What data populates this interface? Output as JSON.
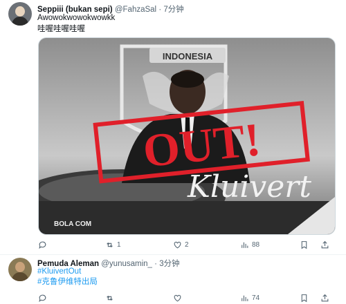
{
  "post1": {
    "display_name": "Seppiii (bukan sepi)",
    "handle": "@FahzaSal",
    "separator": "·",
    "time": "7分钟",
    "text_line1": "Awowokwowokwowkk",
    "text_line2": "哇喔哇喔哇喔",
    "media": {
      "badge_text": "INDONESIA",
      "stamp_text": "OUT!",
      "signature": "Kluivert",
      "watermark": "BOLA COM",
      "stamp_color": "#e0202a"
    },
    "actions": {
      "reply_count": "",
      "retweet_count": "1",
      "like_count": "2",
      "views_count": "88"
    }
  },
  "post2": {
    "display_name": "Pemuda Aleman",
    "handle": "@yunusamin_",
    "separator": "·",
    "time": "3分钟",
    "hashtag1": "#KluivertOut",
    "hashtag2": "#克鲁伊维特出局",
    "actions": {
      "reply_count": "",
      "retweet_count": "",
      "like_count": "",
      "views_count": "74"
    }
  },
  "icons": {
    "reply": "reply-icon",
    "retweet": "retweet-icon",
    "like": "heart-icon",
    "views": "views-icon",
    "bookmark": "bookmark-icon",
    "share": "share-icon"
  },
  "colors": {
    "link": "#1d9bf0",
    "muted": "#536471"
  }
}
